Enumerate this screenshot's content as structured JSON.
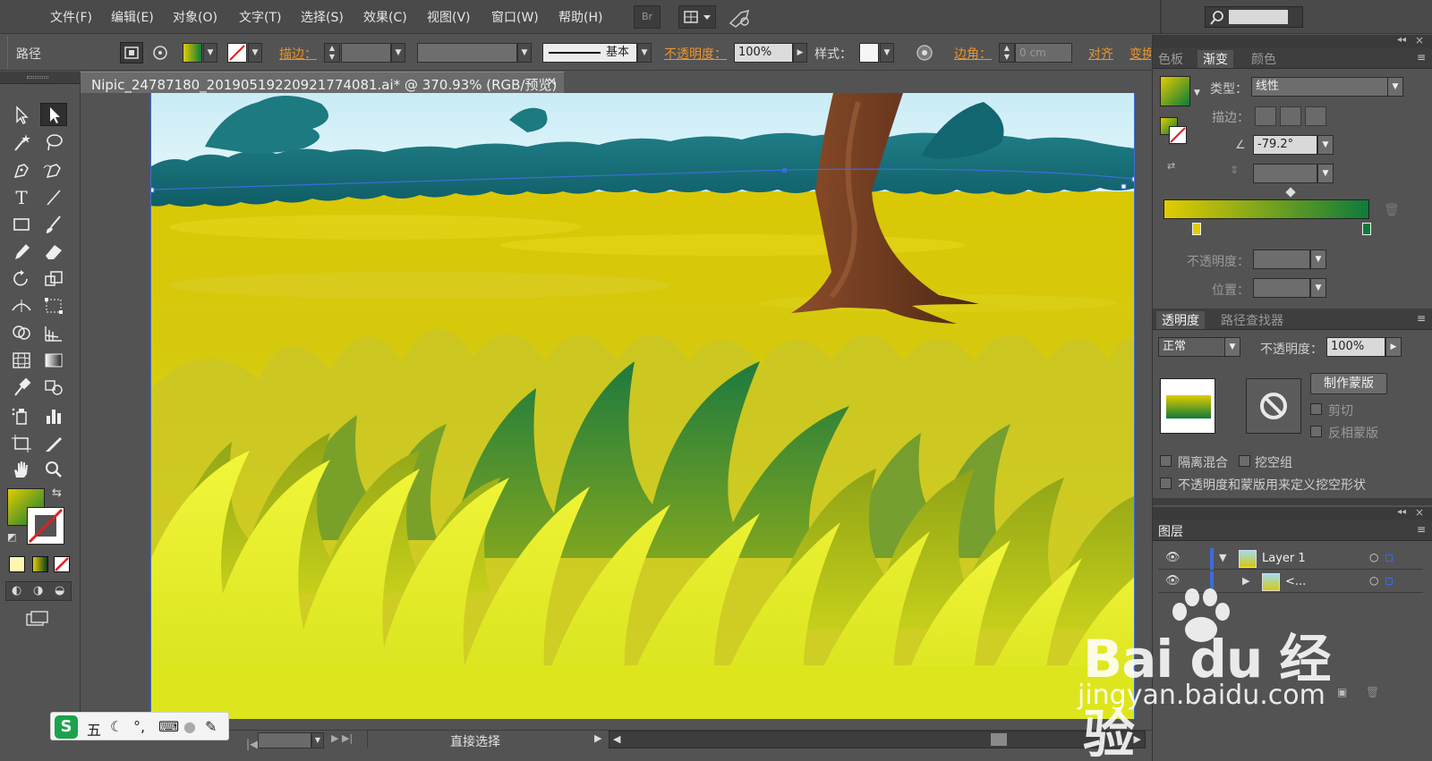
{
  "menubar": {
    "items": [
      "文件(F)",
      "编辑(E)",
      "对象(O)",
      "文字(T)",
      "选择(S)",
      "效果(C)",
      "视图(V)",
      "窗口(W)",
      "帮助(H)"
    ],
    "bridge_label": "Br"
  },
  "controlbar": {
    "selection_type": "路径",
    "stroke_label": "描边：",
    "stroke_style": "基本",
    "opacity_label": "不透明度：",
    "opacity_value": "100%",
    "style_label": "样式：",
    "corner_label": "边角：",
    "corner_value": "0 cm",
    "align_label": "对齐",
    "transform_label": "变换"
  },
  "document": {
    "tab_title": "Nipic_24787180_20190519220921774081.ai* @ 370.93% (RGB/预览)",
    "close_glyph": "×"
  },
  "statusbar": {
    "tool_name": "直接选择"
  },
  "ime": {
    "mode": "五"
  },
  "gradient_panel": {
    "tabs": [
      "色板",
      "渐变",
      "颜色"
    ],
    "active_tab": "渐变",
    "type_label": "类型：",
    "type_value": "线性",
    "stroke_label": "描边：",
    "angle_value": "-79.2°",
    "opacity_label": "不透明度：",
    "location_label": "位置：",
    "start_color": "#e3cc00",
    "end_color": "#0e7a3a"
  },
  "transparency_panel": {
    "tabs": [
      "透明度",
      "路径查找器"
    ],
    "blend_mode": "正常",
    "opacity_label": "不透明度：",
    "opacity_value": "100%",
    "make_mask_label": "制作蒙版",
    "clip_label": "剪切",
    "invert_mask_label": "反相蒙版",
    "isolate_blending_label": "隔离混合",
    "knockout_group_label": "挖空组",
    "opacity_mask_knockout_label": "不透明度和蒙版用来定义挖空形状"
  },
  "layers_panel": {
    "tab": "图层",
    "layers": [
      {
        "name": "Layer 1",
        "expanded": true
      },
      {
        "name": "<...",
        "expanded": false
      }
    ]
  },
  "watermark": {
    "logo": "Bai du 经验",
    "url": "jingyan.baidu.com"
  },
  "colors": {
    "ui_bg": "#535353",
    "accent_orange": "#e9942e",
    "selection_blue": "#3d6cd8"
  }
}
